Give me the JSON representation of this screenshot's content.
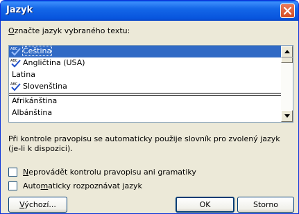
{
  "window": {
    "title": "Jazyk",
    "close_glyph": "✕"
  },
  "prompt": {
    "before": "O",
    "after": "značte jazyk vybraného textu:"
  },
  "languages": {
    "top_items": [
      {
        "label": "Čeština",
        "spell_icon": true,
        "selected": true
      },
      {
        "label": "Angličtina (USA)",
        "spell_icon": true,
        "selected": false
      },
      {
        "label": "Latina",
        "spell_icon": false,
        "selected": false
      },
      {
        "label": "Slovenština",
        "spell_icon": true,
        "selected": false
      }
    ],
    "bottom_items": [
      {
        "label": "Afrikánština"
      },
      {
        "label": "Albánština"
      }
    ]
  },
  "info_text": "Při kontrole pravopisu se automaticky použije slovník pro zvolený jazyk (je-li k dispozici).",
  "options": {
    "no_check": {
      "before": "",
      "key": "N",
      "after": "eprovádět kontrolu pravopisu ani gramatiky",
      "checked": false
    },
    "auto_detect": {
      "before": "Auto",
      "key": "m",
      "after": "aticky rozpoznávat jazyk",
      "checked": false
    }
  },
  "buttons": {
    "default": {
      "key": "V",
      "after": "ýchozí..."
    },
    "ok": "OK",
    "cancel": "Storno"
  },
  "colors": {
    "title_bar": "#0a5ee6",
    "selection": "#316ac5",
    "close_button": "#d44b22",
    "dialog_bg": "#ece9d8"
  }
}
